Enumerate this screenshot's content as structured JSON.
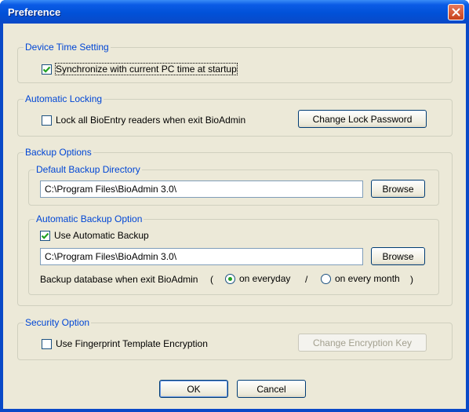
{
  "window": {
    "title": "Preference"
  },
  "device_time": {
    "legend": "Device Time Setting",
    "sync_label": "Synchronize with current PC time at startup",
    "sync_checked": true
  },
  "locking": {
    "legend": "Automatic Locking",
    "lock_label": "Lock all BioEntry readers when exit BioAdmin",
    "lock_checked": false,
    "change_password_label": "Change Lock Password"
  },
  "backup": {
    "legend": "Backup Options",
    "default_dir": {
      "legend": "Default Backup Directory",
      "path": "C:\\Program Files\\BioAdmin 3.0\\",
      "browse_label": "Browse"
    },
    "auto": {
      "legend": "Automatic Backup Option",
      "use_label": "Use Automatic Backup",
      "use_checked": true,
      "path": "C:\\Program Files\\BioAdmin 3.0\\",
      "browse_label": "Browse",
      "schedule_text": "Backup database when exit BioAdmin",
      "open_paren": "(",
      "slash": "/",
      "close_paren": ")",
      "option_everyday": "on everyday",
      "option_every_month": "on every month",
      "selected": "on everyday"
    }
  },
  "security": {
    "legend": "Security Option",
    "encrypt_label": "Use Fingerprint Template Encryption",
    "encrypt_checked": false,
    "change_key_label": "Change Encryption Key"
  },
  "footer": {
    "ok_label": "OK",
    "cancel_label": "Cancel"
  },
  "colors": {
    "legend": "#0046d5",
    "titlebar": "#0151d8",
    "dialog_bg": "#ece9d8",
    "check": "#21a121"
  }
}
